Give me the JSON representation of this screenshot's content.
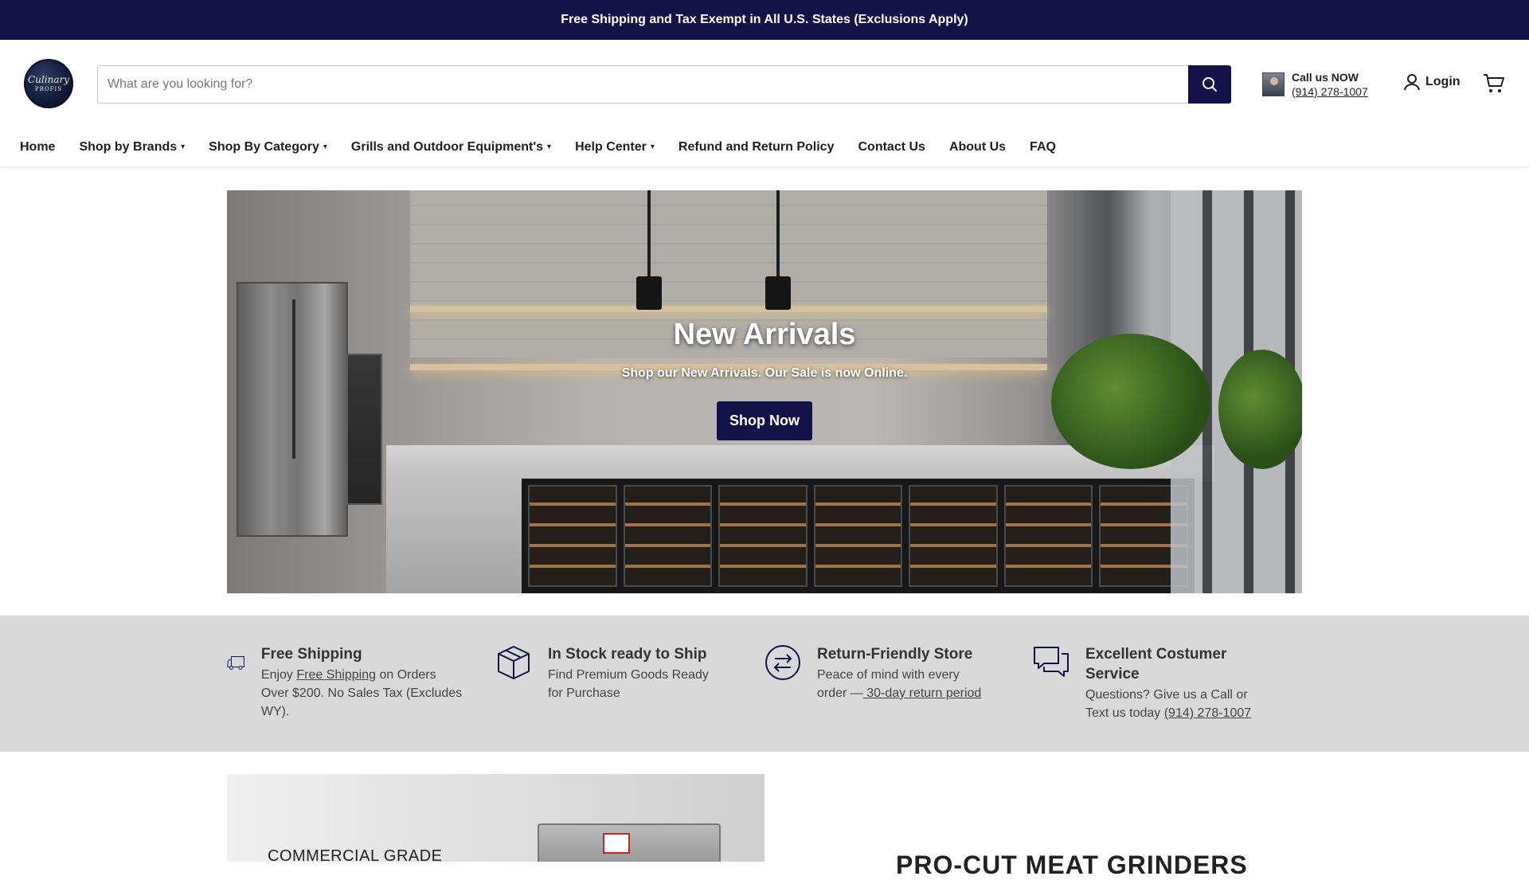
{
  "announcement": "Free Shipping and Tax Exempt in All U.S. States (Exclusions Apply)",
  "logo": {
    "line1": "Culinary",
    "line2": "PROFIS"
  },
  "search": {
    "placeholder": "What are you looking for?",
    "value": ""
  },
  "call": {
    "label": "Call us NOW",
    "phone": "(914) 278-1007"
  },
  "account": {
    "login_label": "Login"
  },
  "nav": [
    {
      "label": "Home",
      "dropdown": false
    },
    {
      "label": "Shop by Brands",
      "dropdown": true
    },
    {
      "label": "Shop By Category",
      "dropdown": true
    },
    {
      "label": "Grills and Outdoor Equipment's",
      "dropdown": true
    },
    {
      "label": "Help Center",
      "dropdown": true
    },
    {
      "label": "Refund and Return Policy",
      "dropdown": false
    },
    {
      "label": "Contact Us",
      "dropdown": false
    },
    {
      "label": "About Us",
      "dropdown": false
    },
    {
      "label": "FAQ",
      "dropdown": false
    }
  ],
  "hero": {
    "title": "New Arrivals",
    "subtitle": "Shop our New Arrivals. Our Sale is now Online.",
    "button": "Shop Now"
  },
  "features": [
    {
      "icon": "truck-icon",
      "title": "Free Shipping",
      "desc_pre": "Enjoy ",
      "link": "Free Shipping",
      "desc_post": " on Orders Over $200. No Sales Tax (Excludes WY)."
    },
    {
      "icon": "box-icon",
      "title": "In Stock ready to Ship",
      "desc_pre": "Find Premium Goods Ready for Purchase",
      "link": "",
      "desc_post": ""
    },
    {
      "icon": "return-arrows-icon",
      "title": "Return-Friendly Store",
      "desc_pre": "Peace of mind with every order —",
      "link": " 30-day return period",
      "desc_post": ""
    },
    {
      "icon": "chat-bubbles-icon",
      "title": "Excellent Costumer Service",
      "desc_pre": "Questions? Give us a Call or Text us today ",
      "link": "(914) 278-1007",
      "desc_post": ""
    }
  ],
  "promo": {
    "caption": "COMMERCIAL GRADE"
  },
  "section_title": "PRO-CUT MEAT GRINDERS",
  "colors": {
    "brand": "#15124a",
    "feature_bg": "#d9d9d9"
  }
}
